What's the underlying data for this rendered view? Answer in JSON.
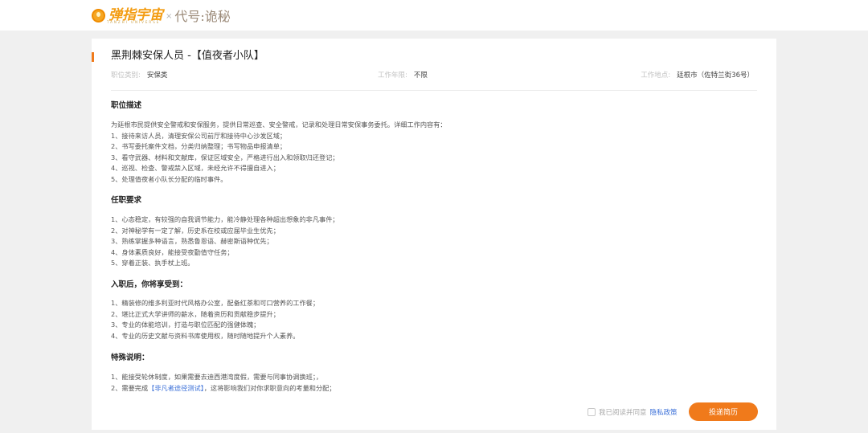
{
  "header": {
    "logo_text": "弹指宇宙",
    "logo_subtext": "TANZHI UNIVERSE",
    "separator": "×",
    "game_title": "代号:诡秘"
  },
  "job": {
    "title": "黑荆棘安保人员 -【值夜者小队】",
    "meta": [
      {
        "label": "职位类别:",
        "value": "安保类"
      },
      {
        "label": "工作年限:",
        "value": "不限"
      },
      {
        "label": "工作地点:",
        "value": "廷根市（佐特兰街36号）"
      }
    ]
  },
  "sections": {
    "description": {
      "title": "职位描述",
      "lines": [
        "为廷根市民提供安全警戒和安保服务，提供日常巡查、安全警戒，记录和处理日常安保事务委托。详细工作内容有：",
        "1、接待来访人员，清理安保公司前厅和接待中心沙发区域；",
        "2、书写委托案件文档，分类归纳整理；书写物品申报清单；",
        "3、看守武器、材料和文献库，保证区域安全，严格进行出入和领取归还登记；",
        "4、巡视、检查、警戒禁入区域，未经允许不得擅自进入；",
        "5、处理值夜者小队长分配的临时事件。"
      ]
    },
    "requirements": {
      "title": "任职要求",
      "lines": [
        "1、心态稳定，有较强的自我调节能力，能冷静处理各种超出想象的非凡事件；",
        "2、对神秘学有一定了解，历史系在校或应届毕业生优先；",
        "3、熟练掌握多种语言，熟悉鲁恩语、赫密斯语种优先；",
        "4、身体素质良好，能接受夜勤值守任务；",
        "5、穿着正装、执手杖上班。"
      ]
    },
    "benefits": {
      "title": "入职后，你将享受到：",
      "lines": [
        "1、精装修的维多利亚时代风格办公室，配备红茶和可口营养的工作餐；",
        "2、堪比正式大学讲师的薪水，随着资历和贡献稳步提升；",
        "3、专业的体能培训，打造与职位匹配的强健体魄；",
        "4、专业的历史文献与资料书库使用权，随时随地提升个人素养。"
      ]
    },
    "notes": {
      "title": "特殊说明：",
      "line1": "1、能接受轮休制度，如果需要去迪西港湾度假，需要与同事协调换班；，",
      "line2_prefix": "2、需要完成",
      "line2_link": "【非凡者途径测试】",
      "line2_suffix": "，这将影响我们对你求职意向的考量和分配；"
    }
  },
  "footer": {
    "agree_text": "我已阅读并同意",
    "privacy_link": "隐私政策",
    "submit_label": "投递简历"
  },
  "colors": {
    "accent": "#f07a1b",
    "link": "#3a6fd8",
    "page_bg": "#f0f0f0"
  }
}
